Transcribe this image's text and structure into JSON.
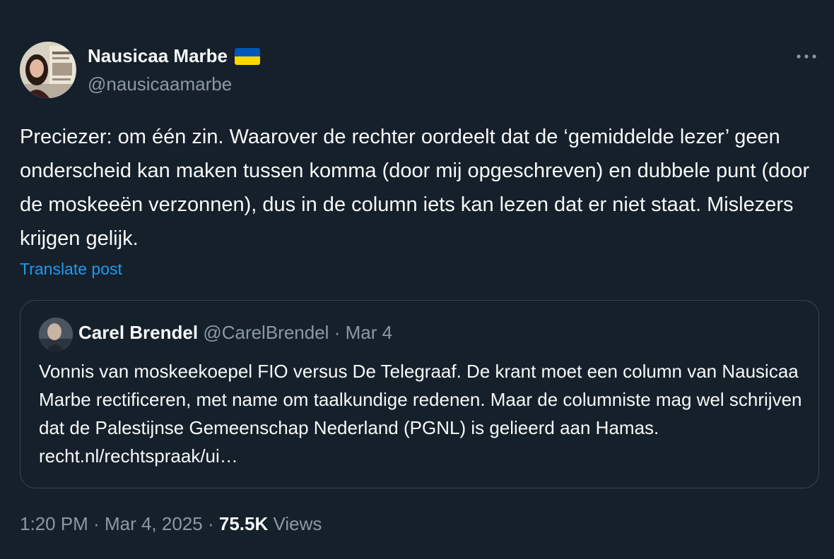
{
  "author": {
    "display_name": "Nausicaa Marbe",
    "handle": "@nausicaamarbe",
    "flag_icon": "ukraine-flag-icon",
    "flag_colors": [
      "#0057b7",
      "#ffd700"
    ]
  },
  "post": {
    "text": "Preciezer: om één zin. Waarover de rechter oordeelt dat de ‘gemiddelde lezer’ geen onderscheid kan maken tussen komma (door mij opgeschreven) en dubbele punt (door de moskeeën verzonnen), dus in de column iets kan lezen dat er niet staat. Mislezers krijgen gelijk.",
    "translate_label": "Translate post"
  },
  "quote": {
    "author_name": "Carel Brendel",
    "author_handle": "@CarelBrendel",
    "separator": "·",
    "date": "Mar 4",
    "text": "Vonnis van moskeekoepel FIO versus De Telegraaf. De krant moet een column van Nausicaa Marbe rectificeren, met name om taalkundige redenen. Maar de columniste mag wel schrijven dat de Palestijnse Gemeenschap Nederland (PGNL) is gelieerd aan Hamas.  recht.nl/rechtspraak/ui…"
  },
  "footer": {
    "time": "1:20 PM",
    "separator": "·",
    "date": "Mar 4, 2025",
    "views_count": "75.5K",
    "views_label": "Views"
  },
  "colors": {
    "background": "#15202b",
    "text": "#f7f9f9",
    "muted": "#8b98a5",
    "link": "#1d9bf0",
    "border": "#38444d"
  }
}
